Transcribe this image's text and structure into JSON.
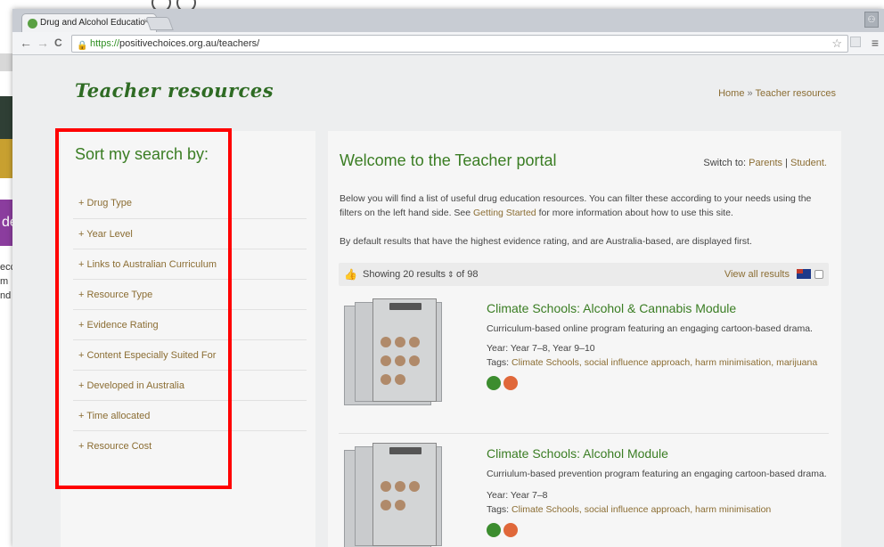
{
  "browser": {
    "tab_title": "Drug and Alcohol Educatio",
    "tab_close": "×",
    "url_scheme": "https://",
    "url_rest": "positivechoices.org.au/teachers/",
    "back": "←",
    "forward": "→",
    "reload": "C",
    "star": "☆",
    "menu": "≡"
  },
  "background_window": {
    "partial_text_1": "de",
    "partial_text_2": "ecc",
    "partial_text_3": "m",
    "partial_text_4": "nd"
  },
  "header": {
    "site_title": "Teacher resources",
    "breadcrumb_home": "Home",
    "breadcrumb_sep": "»",
    "breadcrumb_current": "Teacher resources"
  },
  "sidebar": {
    "heading": "Sort my search by:",
    "filters": [
      "+ Drug Type",
      "+ Year Level",
      "+ Links to Australian Curriculum",
      "+ Resource Type",
      "+ Evidence Rating",
      "+ Content Especially Suited For",
      "+ Developed in Australia",
      "+ Time allocated",
      "+ Resource Cost"
    ]
  },
  "main": {
    "heading": "Welcome to the Teacher portal",
    "switch_prefix": "Switch to:",
    "switch_parents": "Parents",
    "switch_sep": "|",
    "switch_student": "Student.",
    "intro_part1": "Below you will find a list of useful drug education resources. You can filter these according to your needs using the filters on the left hand side. See",
    "intro_link": "Getting Started",
    "intro_part2": "for more information about how to use this site.",
    "intro2": "By default results that have the highest evidence rating, and are Australia-based, are displayed first.",
    "results": {
      "showing": "Showing 20 results",
      "sort_glyph": "⇕",
      "of": "of 98",
      "view_all": "View all results"
    },
    "cards": [
      {
        "title": "Climate Schools: Alcohol & Cannabis Module",
        "desc": "Curriculum-based online program featuring an engaging cartoon-based drama.",
        "year": "Year: Year 7–8, Year 9–10",
        "tags_label": "Tags:",
        "tags": "Climate Schools, social influence approach, harm minimisation, marijuana"
      },
      {
        "title": "Climate Schools: Alcohol Module",
        "desc": "Curriulum-based prevention program featuring an engaging cartoon-based drama.",
        "year": "Year: Year 7–8",
        "tags_label": "Tags:",
        "tags": "Climate Schools, social influence approach, harm minimisation"
      }
    ]
  },
  "colors": {
    "accent_green": "#3a7d23",
    "link_brown": "#8b6d33",
    "highlight_red": "#ff0000"
  }
}
